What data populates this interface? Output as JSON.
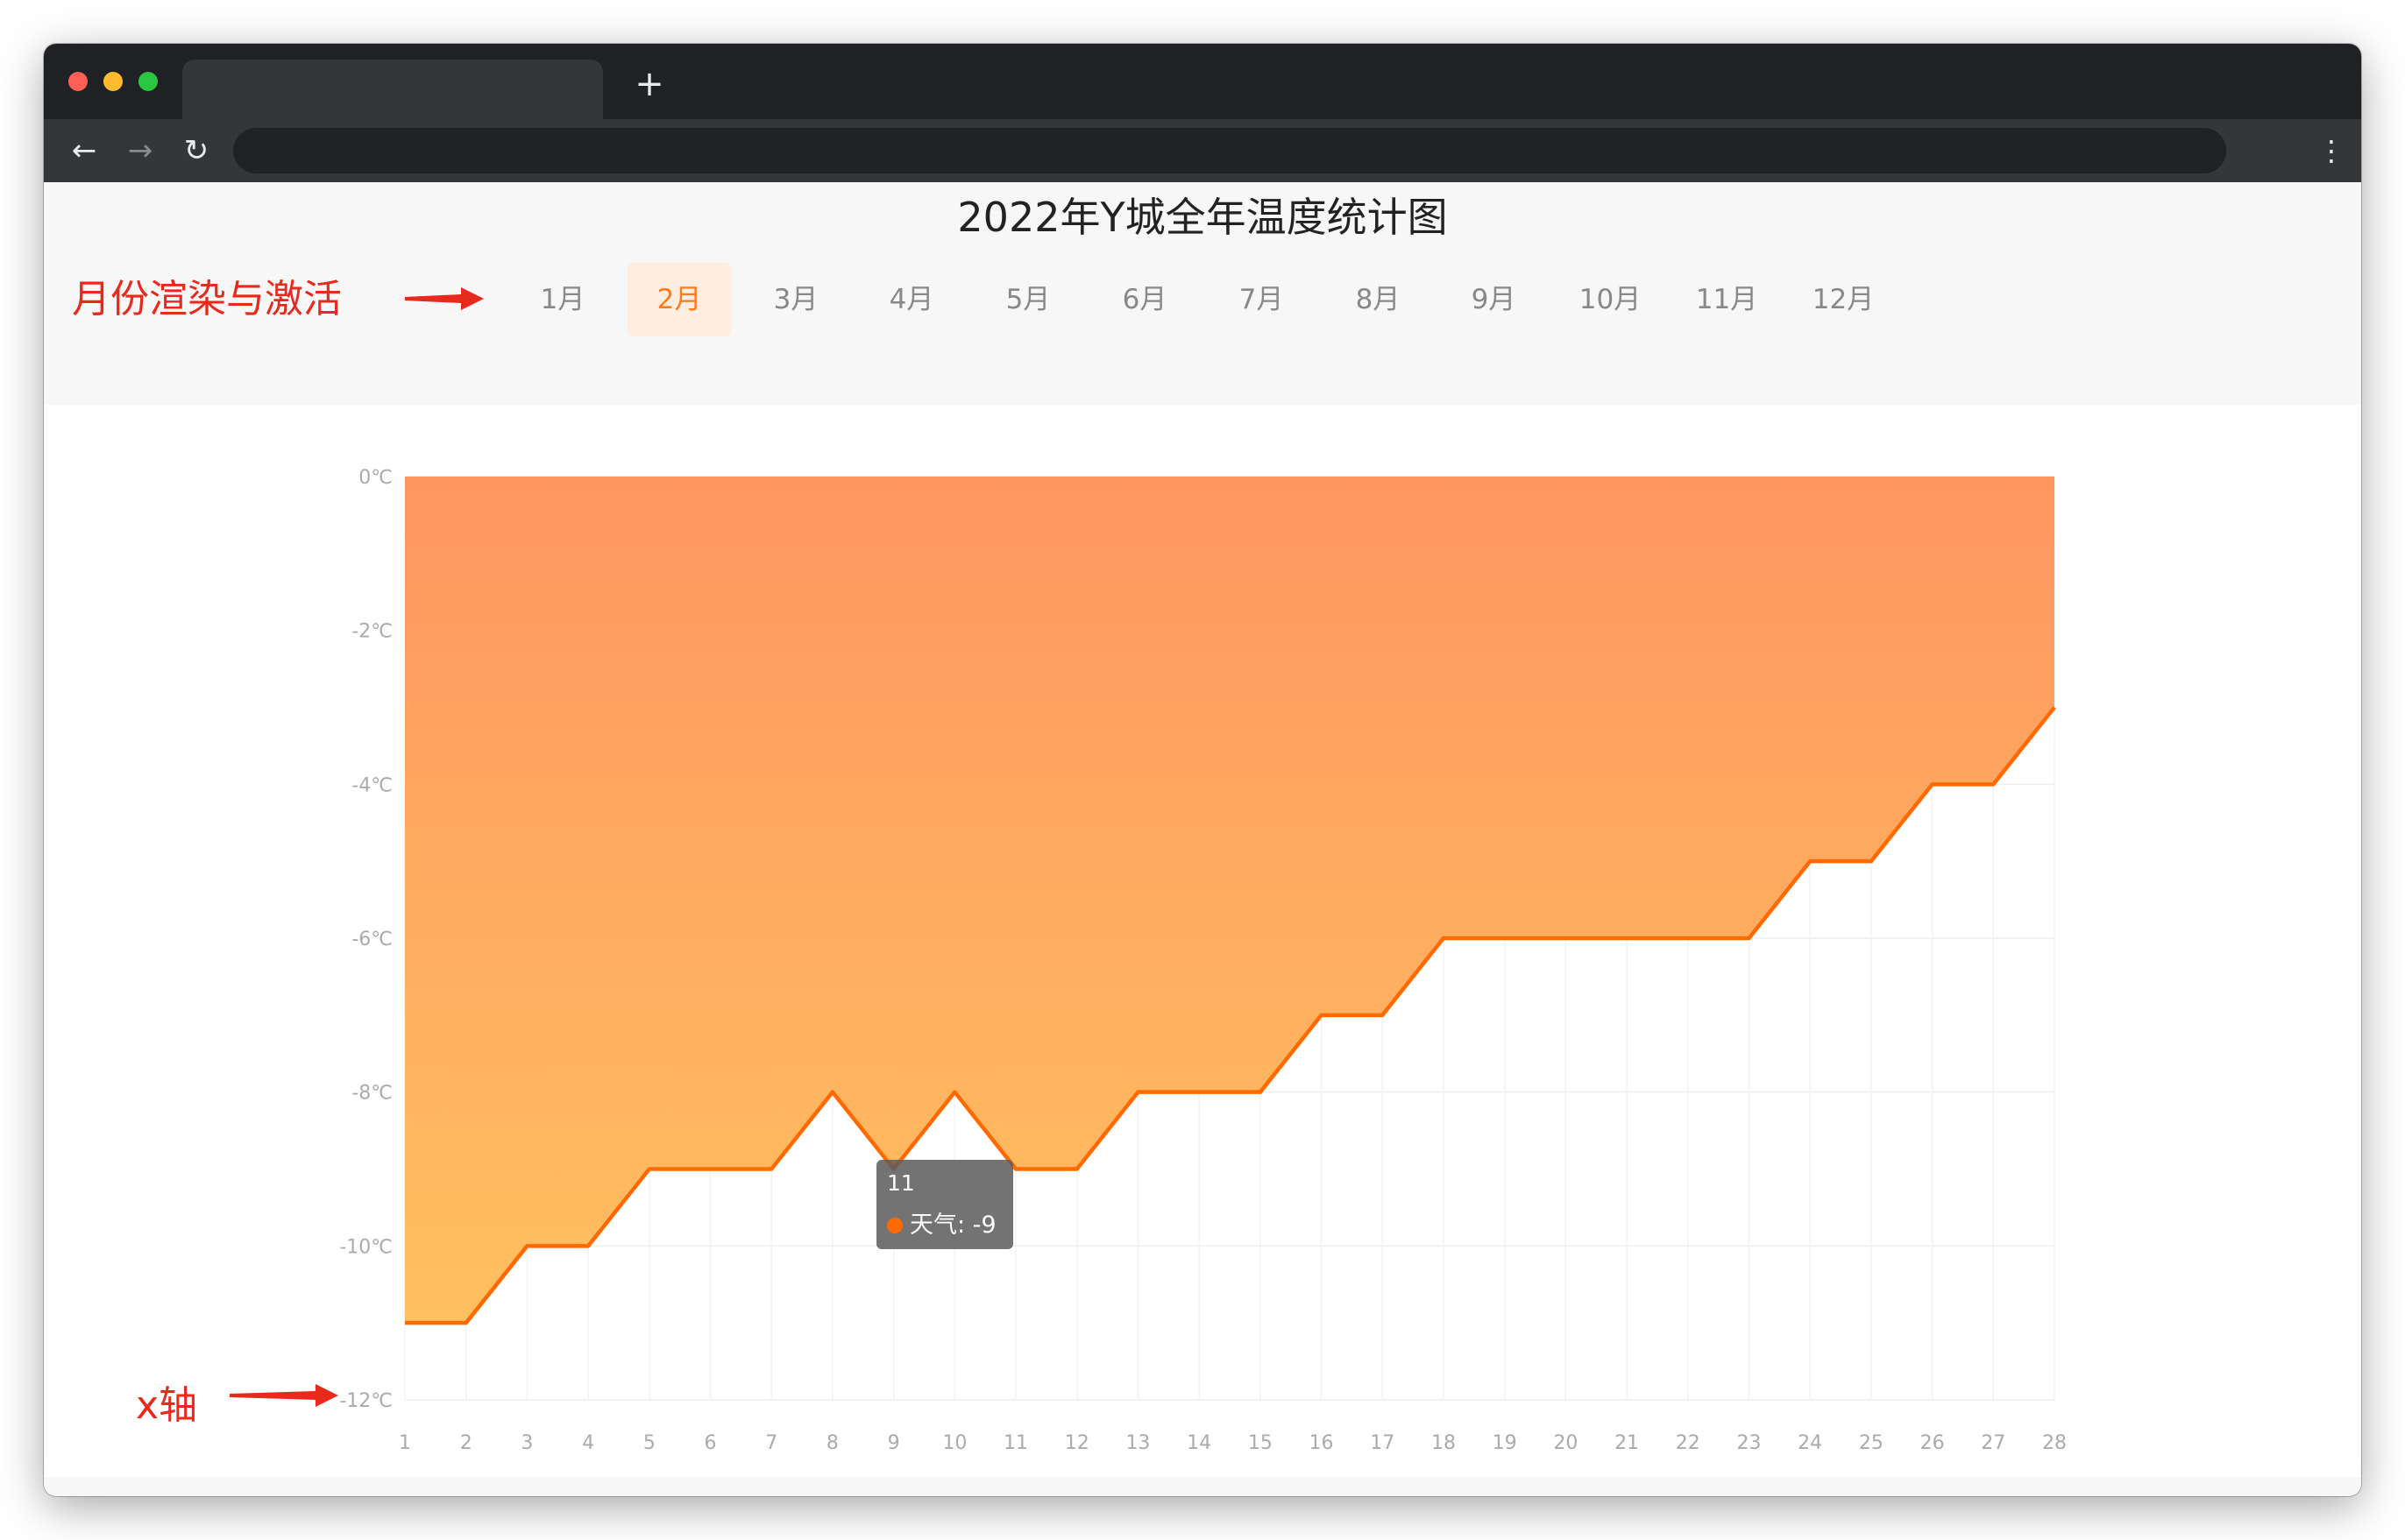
{
  "browser": {
    "new_tab_symbol": "+",
    "back_symbol": "←",
    "forward_symbol": "→",
    "reload_symbol": "↻",
    "menu_symbol": "⋮"
  },
  "page": {
    "title": "2022年Y城全年温度统计图",
    "annotation_months": "月份渲染与激活",
    "annotation_xaxis": "x轴"
  },
  "months": [
    "1月",
    "2月",
    "3月",
    "4月",
    "5月",
    "6月",
    "7月",
    "8月",
    "9月",
    "10月",
    "11月",
    "12月"
  ],
  "active_month": "2月",
  "colors": {
    "accent": "#ff6a00",
    "area_top": "#ff9660",
    "area_bottom": "#ffc060",
    "annotation": "#e8291c",
    "active_tab_bg": "#ffeee0"
  },
  "tooltip": {
    "day": "11",
    "label": "天气: -9"
  },
  "chart_data": {
    "type": "area",
    "x": [
      1,
      2,
      3,
      4,
      5,
      6,
      7,
      8,
      9,
      10,
      11,
      12,
      13,
      14,
      15,
      16,
      17,
      18,
      19,
      20,
      21,
      22,
      23,
      24,
      25,
      26,
      27,
      28
    ],
    "series": [
      {
        "name": "天气",
        "values": [
          -11,
          -11,
          -10,
          -10,
          -9,
          -9,
          -9,
          -8,
          -9,
          -8,
          -9,
          -9,
          -8,
          -8,
          -8,
          -7,
          -7,
          -6,
          -6,
          -6,
          -6,
          -6,
          -6,
          -5,
          -5,
          -4,
          -4,
          -3
        ]
      }
    ],
    "ylim": [
      -12,
      0
    ],
    "y_ticks": [
      0,
      -2,
      -4,
      -6,
      -8,
      -10,
      -12
    ],
    "y_tick_labels": [
      "0℃",
      "-2℃",
      "-4℃",
      "-6℃",
      "-8℃",
      "-10℃",
      "-12℃"
    ],
    "fill_to": "top",
    "grid": true
  }
}
